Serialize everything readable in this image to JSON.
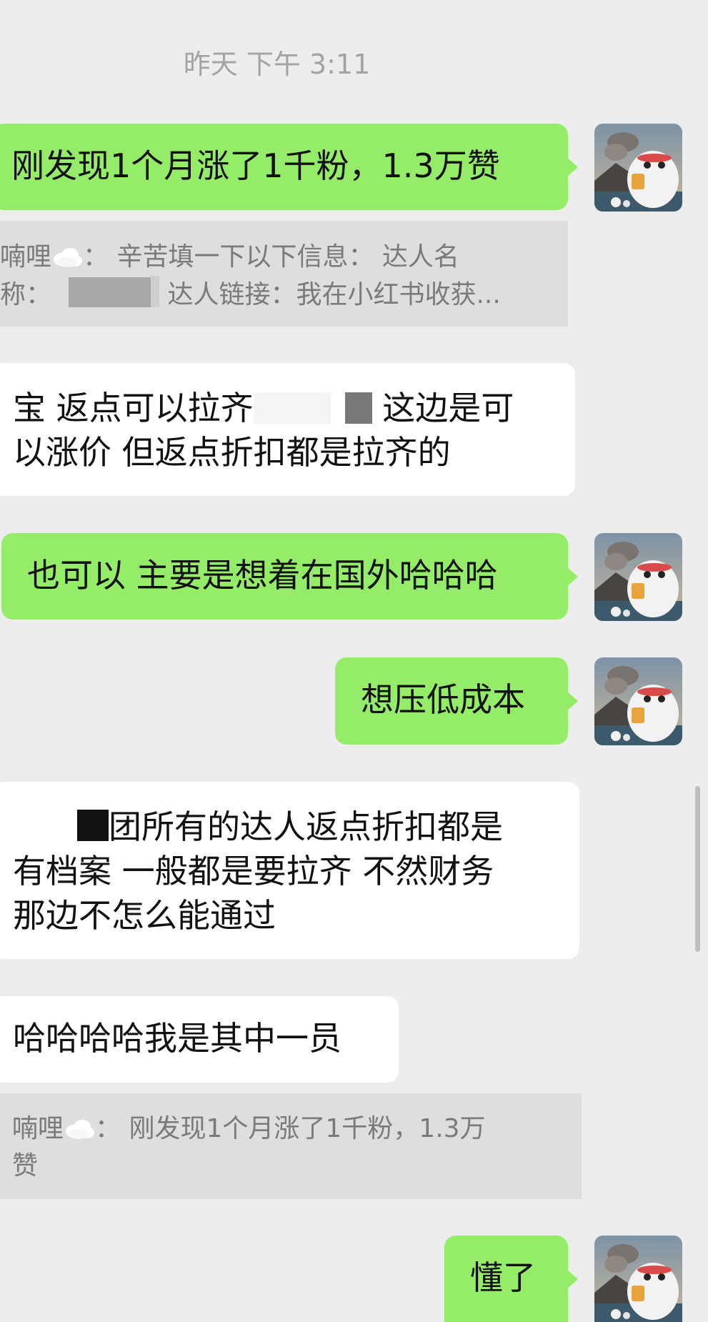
{
  "timestamp": "昨天 下午 3:11",
  "messages": {
    "m1": {
      "text": "刚发现1个月涨了1千粉，1.3万赞"
    },
    "q1": {
      "sender": "喃哩",
      "sep": "：",
      "line1_rest": "辛苦填一下以下信息：  达人名",
      "line2_pre": "称：",
      "line2_rest": "达人链接：我在小红书收获..."
    },
    "m2": {
      "line1_pre": "宝 返点可以拉齐",
      "line1_post": "这边是可",
      "line2": "以涨价 但返点折扣都是拉齐的"
    },
    "m3": {
      "text": "也可以 主要是想着在国外哈哈哈"
    },
    "m4": {
      "text": "想压低成本"
    },
    "m5": {
      "line1": "团所有的达人返点折扣都是",
      "line2": "有档案 一般都是要拉齐 不然财务",
      "line3": "那边不怎么能通过"
    },
    "m6": {
      "text": "哈哈哈哈我是其中一员"
    },
    "q2": {
      "sender": "喃哩",
      "sep": "：",
      "line1_rest": "刚发现1个月涨了1千粉，1.3万",
      "line2": "赞"
    },
    "m7": {
      "text": "懂了"
    }
  },
  "colors": {
    "background": "#ededed",
    "outgoing_bubble": "#95ec69",
    "incoming_bubble": "#ffffff",
    "quote_background": "#dedede",
    "timestamp_text": "#a3a3a3"
  },
  "icons": {
    "avatar": "avatar-volcano-cat",
    "emoji": "cloud-emoji"
  }
}
